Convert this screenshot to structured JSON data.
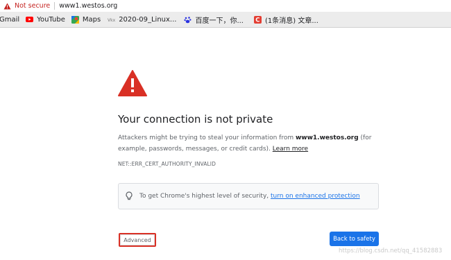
{
  "omnibox": {
    "security_label": "Not secure",
    "url": "www1.westos.org"
  },
  "bookmarks": [
    {
      "label": "Gmail",
      "icon": "gmail-icon"
    },
    {
      "label": "YouTube",
      "icon": "youtube-icon"
    },
    {
      "label": "Maps",
      "icon": "maps-icon"
    },
    {
      "label": "2020-09_Linux...",
      "icon": "page-icon"
    },
    {
      "label": "百度一下，你...",
      "icon": "baidu-paw-icon"
    },
    {
      "label": "(1条消息) 文章...",
      "icon": "csdn-c-icon"
    }
  ],
  "interstitial": {
    "title": "Your connection is not private",
    "body_prefix": "Attackers might be trying to steal your information from ",
    "domain": "www1.westos.org",
    "body_suffix": " (for example, passwords, messages, or credit cards). ",
    "learn_more": "Learn more",
    "error_code": "NET::ERR_CERT_AUTHORITY_INVALID",
    "promo_text": "To get Chrome's highest level of security, ",
    "promo_link": "turn on enhanced protection",
    "advanced_label": "Advanced",
    "back_label": "Back to safety"
  },
  "watermark": "https://blog.csdn.net/qq_41582883",
  "colors": {
    "danger": "#d93025",
    "primary": "#1a73e8",
    "bookmark_bar": "#ececec"
  }
}
